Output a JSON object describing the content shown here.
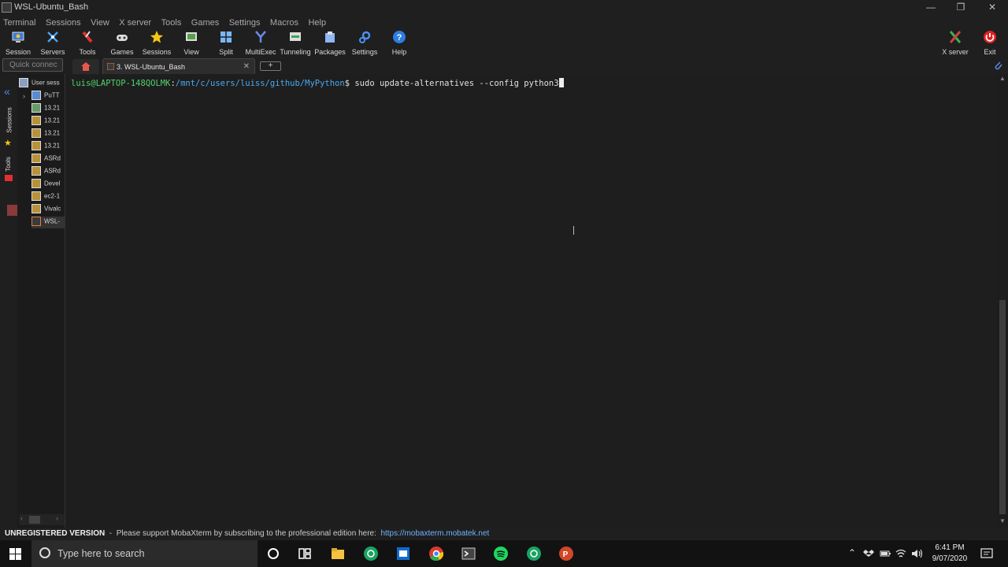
{
  "window": {
    "title": "WSL-Ubuntu_Bash",
    "controls": [
      "minimize-icon",
      "maximize-icon",
      "close-icon"
    ]
  },
  "menu": [
    "Terminal",
    "Sessions",
    "View",
    "X server",
    "Tools",
    "Games",
    "Settings",
    "Macros",
    "Help"
  ],
  "toolbar": {
    "left": [
      {
        "label": "Session",
        "icon": "session-icon"
      },
      {
        "label": "Servers",
        "icon": "servers-icon"
      },
      {
        "label": "Tools",
        "icon": "tools-icon"
      },
      {
        "label": "Games",
        "icon": "games-icon"
      },
      {
        "label": "Sessions",
        "icon": "star-icon"
      },
      {
        "label": "View",
        "icon": "view-icon"
      },
      {
        "label": "Split",
        "icon": "split-icon"
      },
      {
        "label": "MultiExec",
        "icon": "multiexec-icon"
      },
      {
        "label": "Tunneling",
        "icon": "tunneling-icon"
      },
      {
        "label": "Packages",
        "icon": "packages-icon"
      },
      {
        "label": "Settings",
        "icon": "settings-icon"
      },
      {
        "label": "Help",
        "icon": "help-icon"
      }
    ],
    "right": [
      {
        "label": "X server",
        "icon": "x-server-icon"
      },
      {
        "label": "Exit",
        "icon": "power-icon"
      }
    ]
  },
  "tabs": {
    "quick_connect_placeholder": "Quick connec",
    "active_tab": "3. WSL-Ubuntu_Bash",
    "new_tab": "+"
  },
  "side_strip": {
    "sessions_label": "Sessions",
    "tools_label": "Tools"
  },
  "sidebar": {
    "items": [
      {
        "label": "User sess",
        "icon": "user-sessions-icon"
      },
      {
        "label": "PuTT",
        "icon": "putty-icon"
      },
      {
        "label": "13.21",
        "icon": "ssh-icon"
      },
      {
        "label": "13.21",
        "icon": "session-key-icon"
      },
      {
        "label": "13.21",
        "icon": "session-key-icon"
      },
      {
        "label": "13.21",
        "icon": "session-key-icon"
      },
      {
        "label": "ASRd",
        "icon": "session-key-icon"
      },
      {
        "label": "ASRd",
        "icon": "session-key-icon"
      },
      {
        "label": "Devel",
        "icon": "session-key-icon"
      },
      {
        "label": "ec2-1",
        "icon": "session-key-icon"
      },
      {
        "label": "Vivalc",
        "icon": "session-key-icon"
      },
      {
        "label": "WSL-",
        "icon": "wsl-icon"
      }
    ]
  },
  "terminal": {
    "user_host": "luis@LAPTOP-148QOLMK",
    "path": "/mnt/c/users/luiss/github/MyPython",
    "prompt_symbol": "$",
    "command": "sudo update-alternatives --config python3"
  },
  "status": {
    "unregistered": "UNREGISTERED VERSION",
    "message": "  -  Please support MobaXterm by subscribing to the professional edition here:  ",
    "link": "https://mobaxterm.mobatek.net"
  },
  "taskbar": {
    "search_placeholder": "Type here to search",
    "apps": [
      "cortana-icon",
      "task-view-icon",
      "file-explorer-icon",
      "chatgpt-icon",
      "mail-icon",
      "chrome-icon",
      "mobaxterm-icon",
      "spotify-icon",
      "chatgpt-icon",
      "powerpoint-icon"
    ],
    "tray": [
      "chevron-up-icon",
      "dropbox-icon",
      "battery-icon",
      "wifi-icon",
      "volume-icon"
    ],
    "time": "6:41 PM",
    "date": "9/07/2020"
  },
  "colors": {
    "prompt_user": "#4ed36b",
    "prompt_path": "#4aa9f0",
    "link": "#6fb3ff",
    "background": "#1e1e1e"
  }
}
